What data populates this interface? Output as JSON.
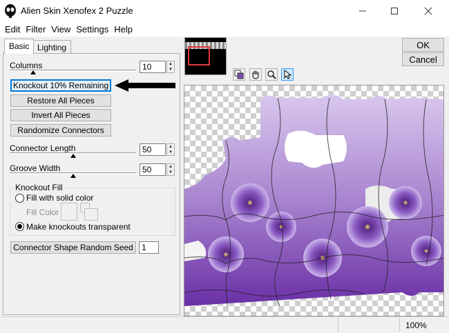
{
  "window": {
    "title": "Alien Skin Xenofex 2 Puzzle"
  },
  "menu": [
    "Edit",
    "Filter",
    "View",
    "Settings",
    "Help"
  ],
  "tabs": [
    "Basic",
    "Lighting"
  ],
  "basic": {
    "columns_label": "Columns",
    "columns_value": "10",
    "knockout_button": "Knockout 10% Remaining",
    "restore_button": "Restore All Pieces",
    "invert_button": "Invert All Pieces",
    "randomize_button": "Randomize Connectors",
    "connector_length_label": "Connector Length",
    "connector_length_value": "50",
    "groove_width_label": "Groove Width",
    "groove_width_value": "50",
    "knockout_fill_title": "Knockout Fill",
    "fill_solid_label": "Fill with solid color",
    "fill_color_label": "Fill Color",
    "transparent_label": "Make knockouts transparent",
    "seed_button": "Connector Shape Random Seed",
    "seed_value": "1"
  },
  "dialog": {
    "ok": "OK",
    "cancel": "Cancel"
  },
  "status": {
    "zoom": "100%"
  },
  "colors": {
    "accent": "#0078d7",
    "selection": "#e23b3b",
    "purple": "#7b4fb0"
  }
}
